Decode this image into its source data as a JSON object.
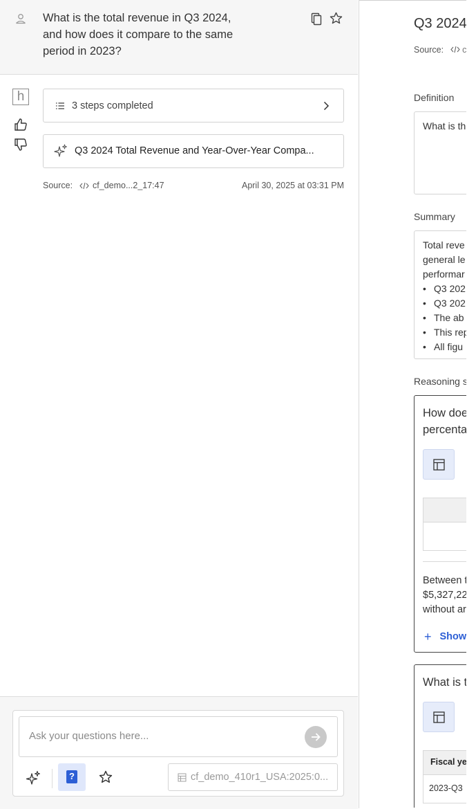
{
  "question": {
    "text": "What is the total revenue in Q3 2024, and how does it compare to the same period in 2023?"
  },
  "logo": {
    "letter": "h"
  },
  "steps_card": {
    "label": "3 steps completed"
  },
  "answer_card": {
    "title": "Q3 2024 Total Revenue and Year-Over-Year Compa..."
  },
  "source": {
    "label": "Source:",
    "file": "cf_demo...2_17:47",
    "date": "April 30, 2025 at 03:31 PM"
  },
  "composer": {
    "placeholder": "Ask your questions here...",
    "dataset": "cf_demo_410r1_USA:2025:0..."
  },
  "right": {
    "title": "Q3 2024",
    "source_label": "Source:",
    "source_mini": "c",
    "definition_label": "Definition",
    "definition_text": "What is th",
    "summary_label": "Summary",
    "summary_lines": [
      "Total reve",
      "general le",
      "performar"
    ],
    "summary_bullets": [
      "Q3 202",
      "Q3 202",
      "The ab",
      "This rep",
      "All figu"
    ],
    "reasoning_label": "Reasoning s",
    "card1": {
      "question_lines": [
        "How doe",
        "percenta"
      ],
      "paragraph_lines": [
        "Between t",
        "$5,327,22",
        "without ar"
      ],
      "show_more": "Show"
    },
    "card2": {
      "question": "What is t",
      "table_header": "Fiscal yea",
      "table_cell": "2023-Q3"
    }
  },
  "colors": {
    "accent": "#2d5fd5",
    "header_bg": "#f6f6f6",
    "toggle_bg": "#e6ecfa"
  }
}
